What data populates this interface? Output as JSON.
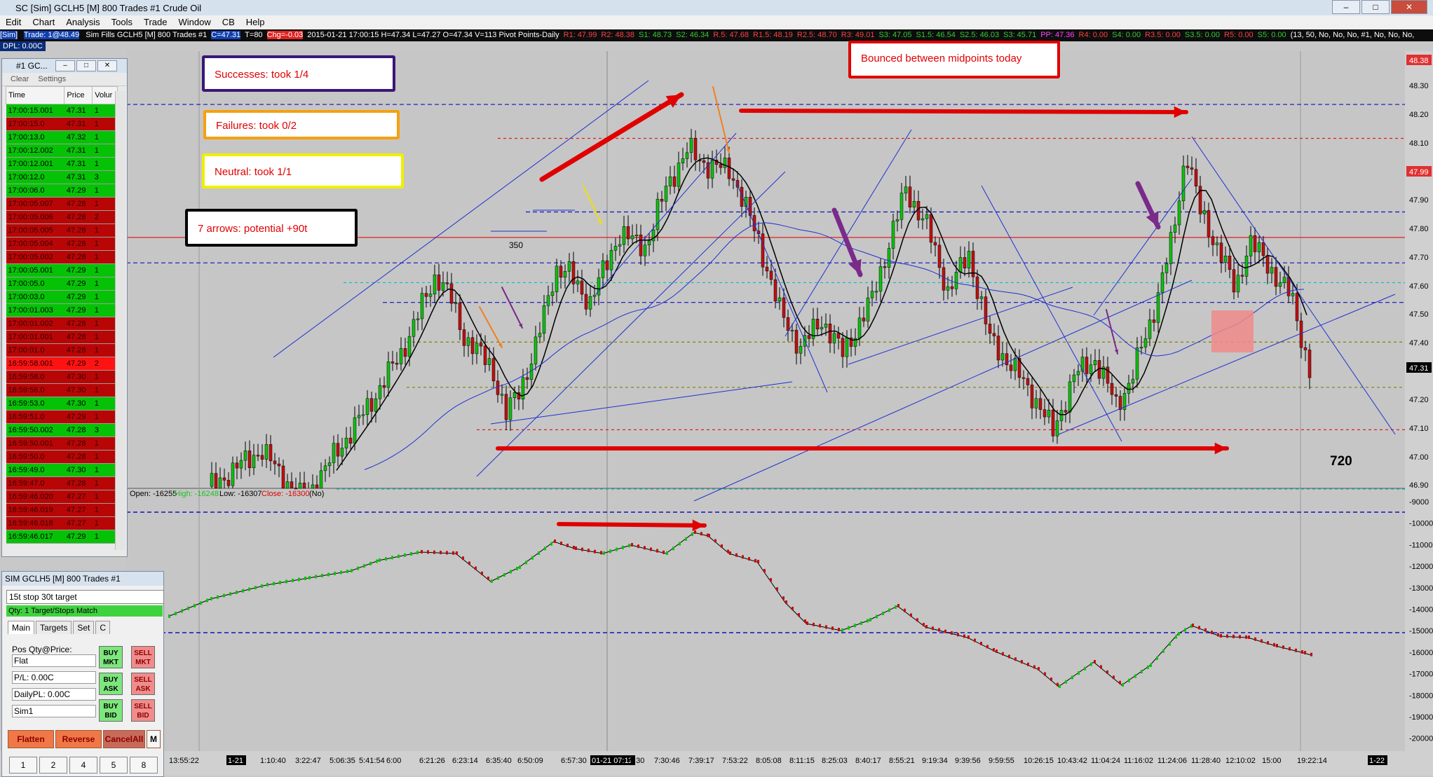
{
  "window": {
    "title": "SC [Sim] GCLH5 [M]  800 Trades  #1  Crude Oil"
  },
  "menu": [
    "Edit",
    "Chart",
    "Analysis",
    "Tools",
    "Trade",
    "Window",
    "CB",
    "Help"
  ],
  "chart_header": {
    "sim": "[Sim]",
    "trade": "Trade: 1@48.49",
    "items": [
      {
        "text": "Sim Fills  GCLH5 [M]  800 Trades  #1",
        "color": "#ffffff"
      },
      {
        "text": "C=47.31",
        "color": "#ffffff",
        "bg": "#1040b0"
      },
      {
        "text": "T=80",
        "color": "#ffffff"
      },
      {
        "text": "Chg=-0.03",
        "color": "#ffffff",
        "bg": "#e02020"
      },
      {
        "text": "2015-01-21  17:00:15  H=47.34  L=47.27  O=47.34  V=113  Pivot Points-Daily",
        "color": "#ffffff"
      },
      {
        "text": "R1: 47.99",
        "color": "#ff4040"
      },
      {
        "text": "R2: 48.38",
        "color": "#ff4040"
      },
      {
        "text": "S1: 48.73",
        "color": "#33cc33"
      },
      {
        "text": "S2: 46.34",
        "color": "#33cc33"
      },
      {
        "text": "R.5: 47.68",
        "color": "#ff4040"
      },
      {
        "text": "R1.5: 48.19",
        "color": "#ff4040"
      },
      {
        "text": "R2.5: 48.70",
        "color": "#ff4040"
      },
      {
        "text": "R3: 49.01",
        "color": "#ff4040"
      },
      {
        "text": "S3: 47.05",
        "color": "#33cc33"
      },
      {
        "text": "S1.5: 46.54",
        "color": "#33cc33"
      },
      {
        "text": "S2.5: 46.03",
        "color": "#33cc33"
      },
      {
        "text": "S3: 45.71",
        "color": "#33cc33"
      },
      {
        "text": "PP: 47.36",
        "color": "#ff44ff"
      },
      {
        "text": "R4: 0.00",
        "color": "#ff4040"
      },
      {
        "text": "S4: 0.00",
        "color": "#33cc33"
      },
      {
        "text": "R3.5: 0.00",
        "color": "#ff4040"
      },
      {
        "text": "S3.5: 0.00",
        "color": "#33cc33"
      },
      {
        "text": "R5: 0.00",
        "color": "#ff4040"
      },
      {
        "text": "S5: 0.00",
        "color": "#33cc33"
      },
      {
        "text": "(13, 50, No, No, No, #1, No, No, No,",
        "color": "#ffffff"
      }
    ]
  },
  "dpl": "DPL: 0.00C",
  "annotations": {
    "successes": "Successes: took 1/4",
    "failures": "Failures: took 0/2",
    "neutral": "Neutral: took 1/1",
    "arrows": "7 arrows: potential +90t",
    "bounced": "Bounced between midpoints today",
    "label_350": "350",
    "label_720": "720"
  },
  "price_axis": {
    "labels": [
      "48.38",
      "48.30",
      "48.20",
      "48.10",
      "47.99",
      "47.90",
      "47.80",
      "47.70",
      "47.60",
      "47.50",
      "47.40",
      "47.31",
      "47.20",
      "47.10",
      "47.00",
      "46.90"
    ],
    "highlights": {
      "48.38": "#e03030",
      "47.99": "#e03030",
      "47.31": "#000000"
    }
  },
  "lower_axis": {
    "labels": [
      "-9000",
      "-10000",
      "-11000",
      "-12000",
      "-13000",
      "-14000",
      "-15000",
      "-16000",
      "-17000",
      "-18000",
      "-19000",
      "-20000"
    ]
  },
  "ohlc_bar": {
    "open": "Open: -16255",
    "high": "High: -16248",
    "low": "Low: -16307",
    "close": "Close: -16300",
    "no": "(No)"
  },
  "time_axis": {
    "labels": [
      "13:55:22",
      "1-21",
      "1:10:40",
      "3:22:47",
      "5:06:35",
      "5:41:54",
      "6:00",
      "6:21:26",
      "6:23:14",
      "6:35:40",
      "6:50:09",
      "6:57:30",
      "01-21  07:11",
      "9:30",
      "7:30:46",
      "7:39:17",
      "7:53:22",
      "8:05:08",
      "8:11:15",
      "8:25:03",
      "8:40:17",
      "8:55:21",
      "9:19:34",
      "9:39:56",
      "9:59:55",
      "10:26:15",
      "10:43:42",
      "11:04:24",
      "11:16:02",
      "11:24:06",
      "11:28:40",
      "12:10:02",
      "15:00",
      "19:22:14",
      "1-22"
    ]
  },
  "time_sales": {
    "title": "#1 GC...",
    "toolbar": [
      "Clear",
      "Settings"
    ],
    "headers": [
      "Time",
      "Price",
      "Volur"
    ],
    "rows": [
      {
        "t": "17:00:15.001",
        "p": "47.31",
        "v": "1",
        "c": "g"
      },
      {
        "t": "17:00:15.0",
        "p": "47.31",
        "v": "1",
        "c": "r"
      },
      {
        "t": "17:00:13.0",
        "p": "47.32",
        "v": "1",
        "c": "g"
      },
      {
        "t": "17:00:12.002",
        "p": "47.31",
        "v": "1",
        "c": "g"
      },
      {
        "t": "17:00:12.001",
        "p": "47.31",
        "v": "1",
        "c": "g"
      },
      {
        "t": "17:00:12.0",
        "p": "47.31",
        "v": "3",
        "c": "g"
      },
      {
        "t": "17:00:06.0",
        "p": "47.29",
        "v": "1",
        "c": "g"
      },
      {
        "t": "17:00:05.007",
        "p": "47.28",
        "v": "1",
        "c": "r"
      },
      {
        "t": "17:00:05.006",
        "p": "47.28",
        "v": "2",
        "c": "r"
      },
      {
        "t": "17:00:05.005",
        "p": "47.28",
        "v": "1",
        "c": "r"
      },
      {
        "t": "17:00:05.004",
        "p": "47.28",
        "v": "1",
        "c": "r"
      },
      {
        "t": "17:00:05.002",
        "p": "47.28",
        "v": "1",
        "c": "r"
      },
      {
        "t": "17:00:05.001",
        "p": "47.29",
        "v": "1",
        "c": "g"
      },
      {
        "t": "17:00:05.0",
        "p": "47.29",
        "v": "1",
        "c": "g"
      },
      {
        "t": "17:00:03.0",
        "p": "47.29",
        "v": "1",
        "c": "g"
      },
      {
        "t": "17:00:01.003",
        "p": "47.29",
        "v": "1",
        "c": "g"
      },
      {
        "t": "17:00:01.002",
        "p": "47.28",
        "v": "1",
        "c": "r"
      },
      {
        "t": "17:00:01.001",
        "p": "47.28",
        "v": "1",
        "c": "r"
      },
      {
        "t": "17:00:01.0",
        "p": "47.28",
        "v": "1",
        "c": "r"
      },
      {
        "t": "16:59:58.001",
        "p": "47.29",
        "v": "2",
        "c": "hr"
      },
      {
        "t": "16:59:58.0",
        "p": "47.30",
        "v": "1",
        "c": "r"
      },
      {
        "t": "16:59:56.0",
        "p": "47.30",
        "v": "1",
        "c": "r"
      },
      {
        "t": "16:59:53.0",
        "p": "47.30",
        "v": "1",
        "c": "g"
      },
      {
        "t": "16:59:51.0",
        "p": "47.29",
        "v": "1",
        "c": "r"
      },
      {
        "t": "16:59:50.002",
        "p": "47.28",
        "v": "3",
        "c": "g"
      },
      {
        "t": "16:59:50.001",
        "p": "47.28",
        "v": "1",
        "c": "r"
      },
      {
        "t": "16:59:50.0",
        "p": "47.28",
        "v": "1",
        "c": "r"
      },
      {
        "t": "16:59:49.0",
        "p": "47.30",
        "v": "1",
        "c": "g"
      },
      {
        "t": "16:59:47.0",
        "p": "47.28",
        "v": "1",
        "c": "r"
      },
      {
        "t": "16:59:46.020",
        "p": "47.27",
        "v": "1",
        "c": "r"
      },
      {
        "t": "16:59:46.019",
        "p": "47.27",
        "v": "1",
        "c": "r"
      },
      {
        "t": "16:59:46.018",
        "p": "47.27",
        "v": "1",
        "c": "r"
      },
      {
        "t": "16:59:46.017",
        "p": "47.29",
        "v": "1",
        "c": "g"
      }
    ]
  },
  "trade_window": {
    "title": "SIM GCLH5 [M]  800 Trades  #1",
    "strategy": "15t stop 30t target",
    "qty_status": "Qty: 1 Target/Stops Match",
    "tabs": [
      "Main",
      "Targets",
      "Set",
      "C"
    ],
    "pos_label": "Pos Qty@Price:",
    "pos_value": "Flat",
    "pl": "P/L: 0.00C",
    "daily_pl": "DailyPL: 0.00C",
    "account": "Sim1",
    "buttons": {
      "buy_mkt": "BUY MKT",
      "sell_mkt": "SELL MKT",
      "buy_ask": "BUY ASK",
      "sell_ask": "SELL ASK",
      "buy_bid": "BUY BID",
      "sell_bid": "SELL BID",
      "flatten": "Flatten",
      "reverse": "Reverse",
      "cancel_all": "CancelAll",
      "m": "M"
    },
    "qty_buttons": [
      "1",
      "2",
      "4",
      "5",
      "8"
    ]
  }
}
